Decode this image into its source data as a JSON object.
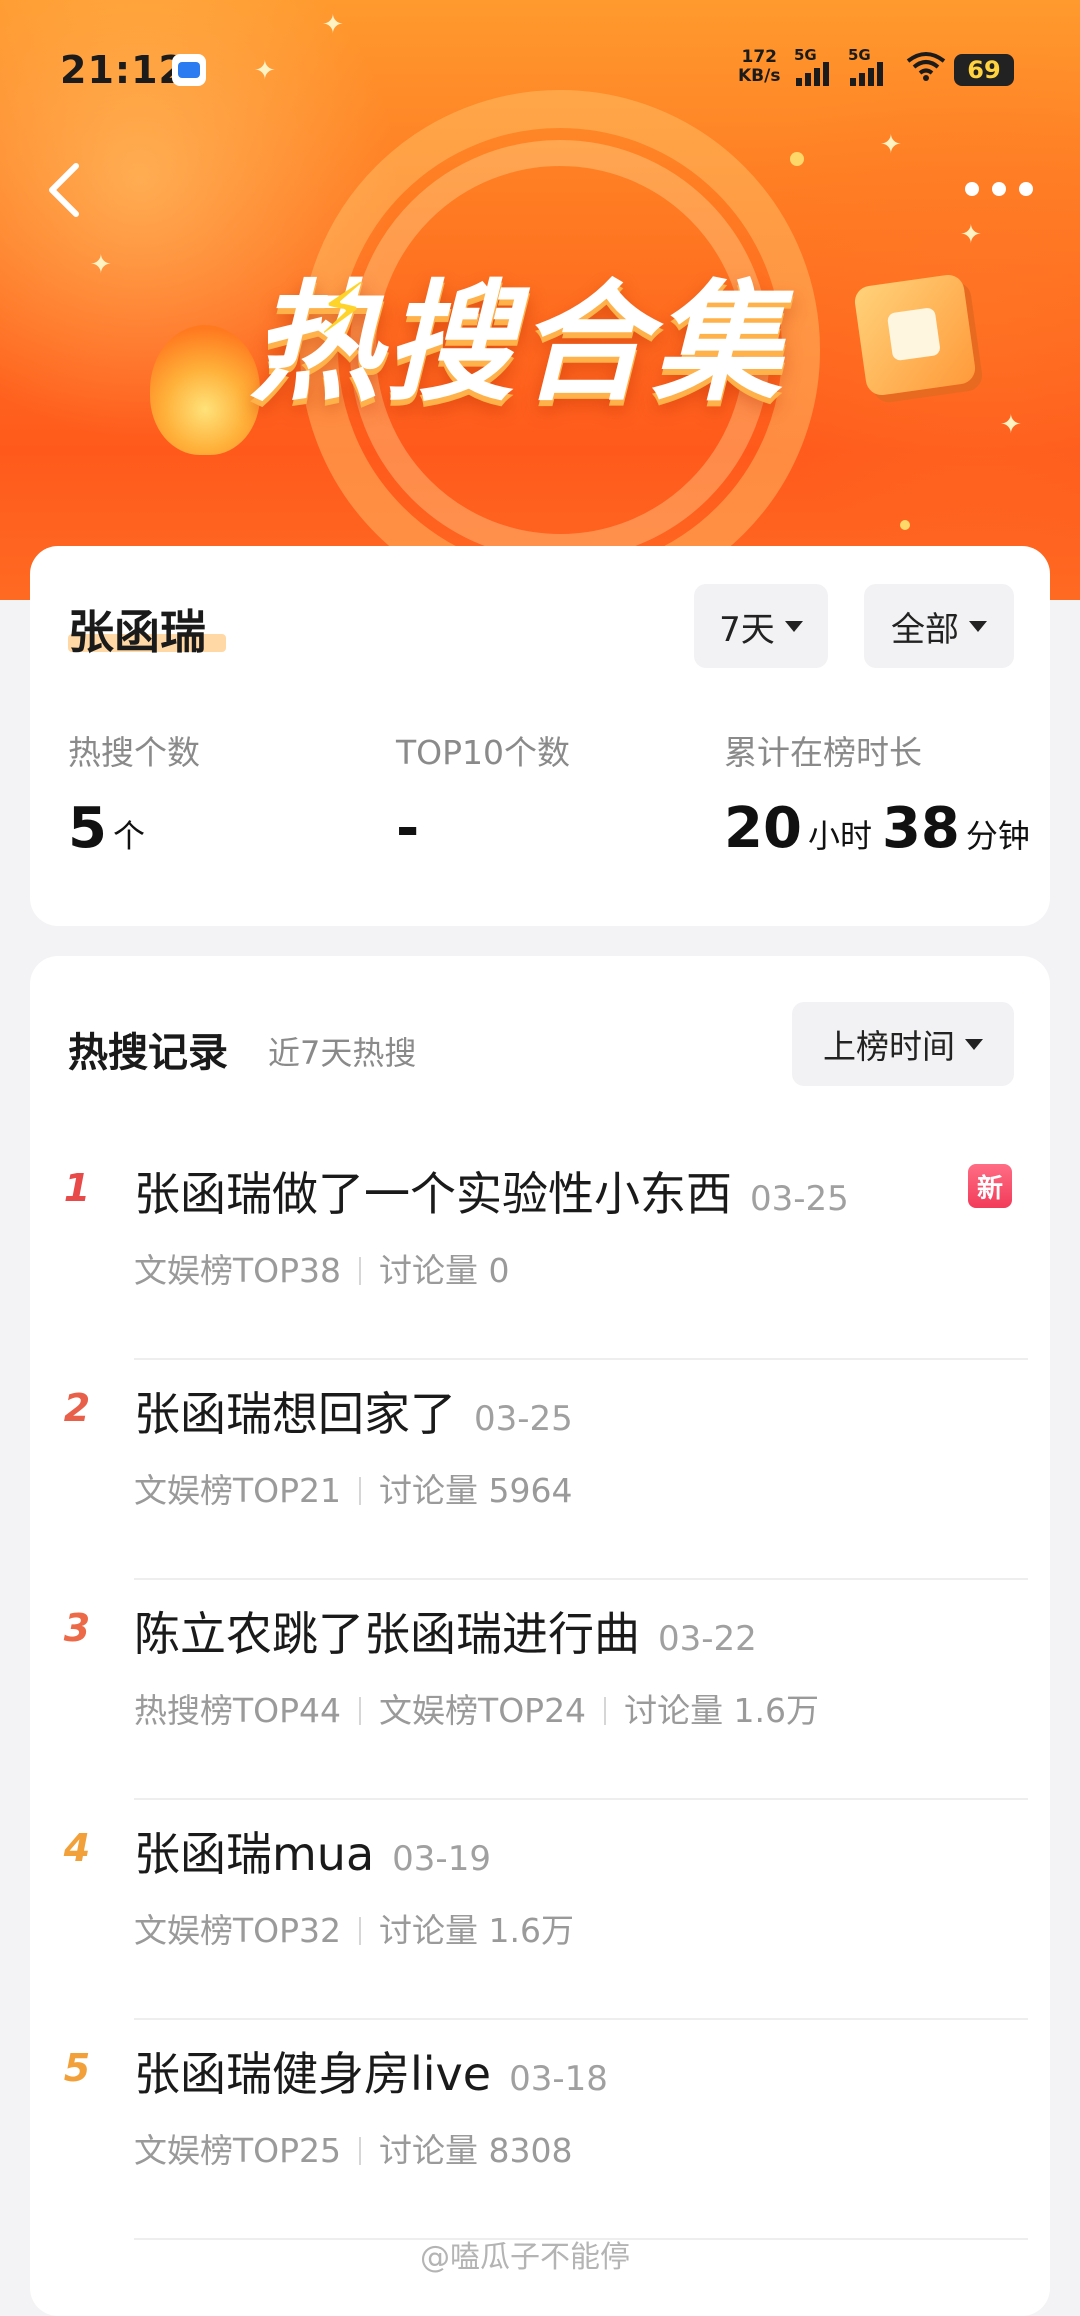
{
  "status_bar": {
    "time": "21:12",
    "speed_value": "172",
    "speed_unit": "KB/s",
    "sig1": "5G",
    "sig2": "5G",
    "battery": "69"
  },
  "header": {
    "banner_title": "热搜合集",
    "back_icon": "chevron-left-icon",
    "more_icon": "more-dots-icon"
  },
  "summary": {
    "name": "张函瑞",
    "filter_days": "7天",
    "filter_scope": "全部",
    "stats": [
      {
        "label": "热搜个数",
        "value": "5",
        "unit": "个"
      },
      {
        "label": "TOP10个数",
        "value": "-"
      },
      {
        "label": "累计在榜时长",
        "hours": "20",
        "hours_unit": "小时",
        "minutes": "38",
        "minutes_unit": "分钟"
      }
    ]
  },
  "records": {
    "title": "热搜记录",
    "subtitle": "近7天热搜",
    "sort_label": "上榜时间",
    "items": [
      {
        "rank": "1",
        "title": "张函瑞做了一个实验性小东西",
        "date": "03-25",
        "badge": "新",
        "meta": [
          "文娱榜TOP38",
          "讨论量 0"
        ],
        "rank_color": "#e84a4a"
      },
      {
        "rank": "2",
        "title": "张函瑞想回家了",
        "date": "03-25",
        "meta": [
          "文娱榜TOP21",
          "讨论量 5964"
        ],
        "rank_color": "#e8604a"
      },
      {
        "rank": "3",
        "title": "陈立农跳了张函瑞进行曲",
        "date": "03-22",
        "meta": [
          "热搜榜TOP44",
          "文娱榜TOP24",
          "讨论量 1.6万"
        ],
        "rank_color": "#ec6a48"
      },
      {
        "rank": "4",
        "title": "张函瑞mua",
        "date": "03-19",
        "meta": [
          "文娱榜TOP32",
          "讨论量 1.6万"
        ],
        "rank_color": "#f2a03a"
      },
      {
        "rank": "5",
        "title": "张函瑞健身房live",
        "date": "03-18",
        "meta": [
          "文娱榜TOP25",
          "讨论量 8308"
        ],
        "rank_color": "#f2a03a"
      }
    ]
  },
  "watermark": "@嗑瓜子不能停"
}
